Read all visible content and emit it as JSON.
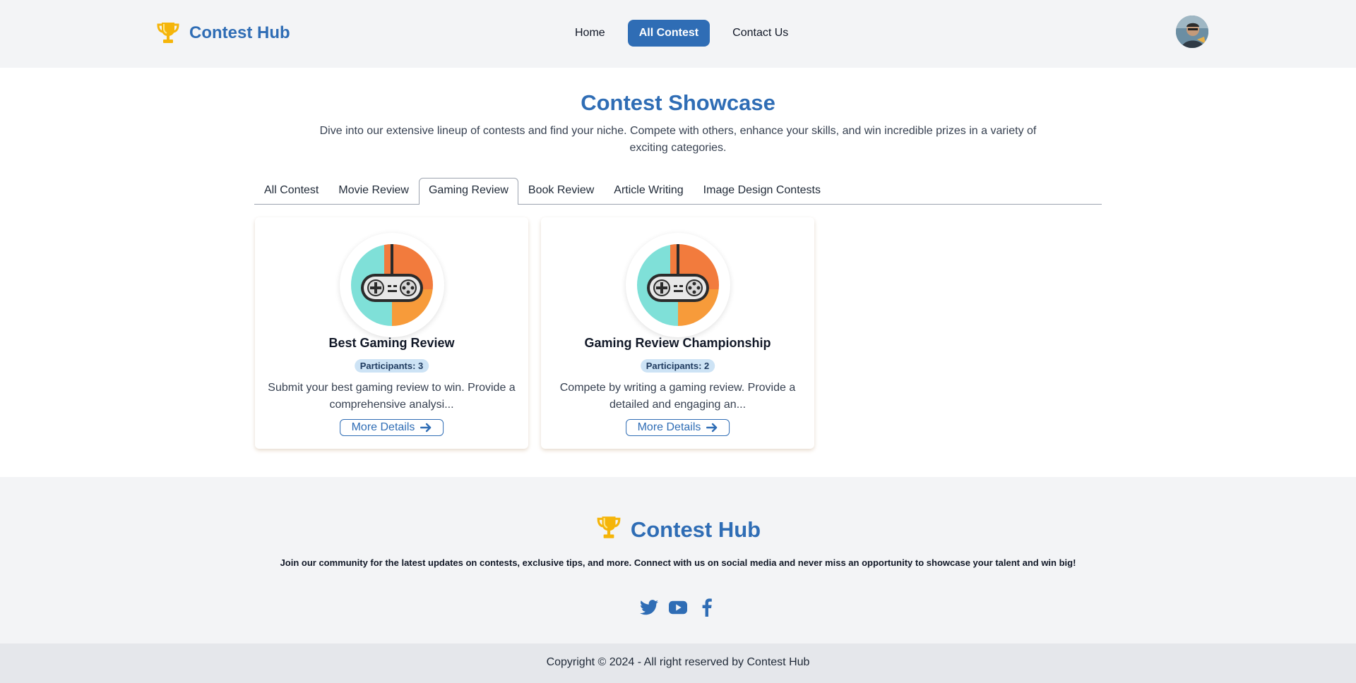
{
  "header": {
    "brand": "Contest Hub",
    "nav": [
      {
        "label": "Home",
        "active": false
      },
      {
        "label": "All Contest",
        "active": true
      },
      {
        "label": "Contact Us",
        "active": false
      }
    ]
  },
  "main": {
    "title": "Contest Showcase",
    "description": "Dive into our extensive lineup of contests and find your niche. Compete with others, enhance your skills, and win incredible prizes in a variety of exciting categories.",
    "tabs": [
      {
        "label": "All Contest",
        "active": false
      },
      {
        "label": "Movie Review",
        "active": false
      },
      {
        "label": "Gaming Review",
        "active": true
      },
      {
        "label": "Book Review",
        "active": false
      },
      {
        "label": "Article Writing",
        "active": false
      },
      {
        "label": "Image Design Contests",
        "active": false
      }
    ],
    "cards": [
      {
        "title": "Best Gaming Review",
        "participants": "Participants: 3",
        "description": "Submit your best gaming review to win. Provide a comprehensive analysi...",
        "button": "More Details",
        "icon": "gamepad-icon"
      },
      {
        "title": "Gaming Review Championship",
        "participants": "Participants: 2",
        "description": "Compete by writing a gaming review. Provide a detailed and engaging an...",
        "button": "More Details",
        "icon": "gamepad-icon"
      }
    ]
  },
  "footer": {
    "brand": "Contest Hub",
    "text": "Join our community for the latest updates on contests, exclusive tips, and more. Connect with us on social media and never miss an opportunity to showcase your talent and win big!",
    "socials": [
      "twitter-icon",
      "youtube-icon",
      "facebook-icon"
    ],
    "copyright": "Copyright © 2024 - All right reserved by Contest Hub"
  },
  "colors": {
    "brand": "#2f6db5",
    "trophy": "#f5b50a",
    "header_bg": "#f3f4f6",
    "footer_bg": "#f3f4f6",
    "copyright_bg": "#e5e7eb",
    "badge_bg": "#cde3f5"
  }
}
